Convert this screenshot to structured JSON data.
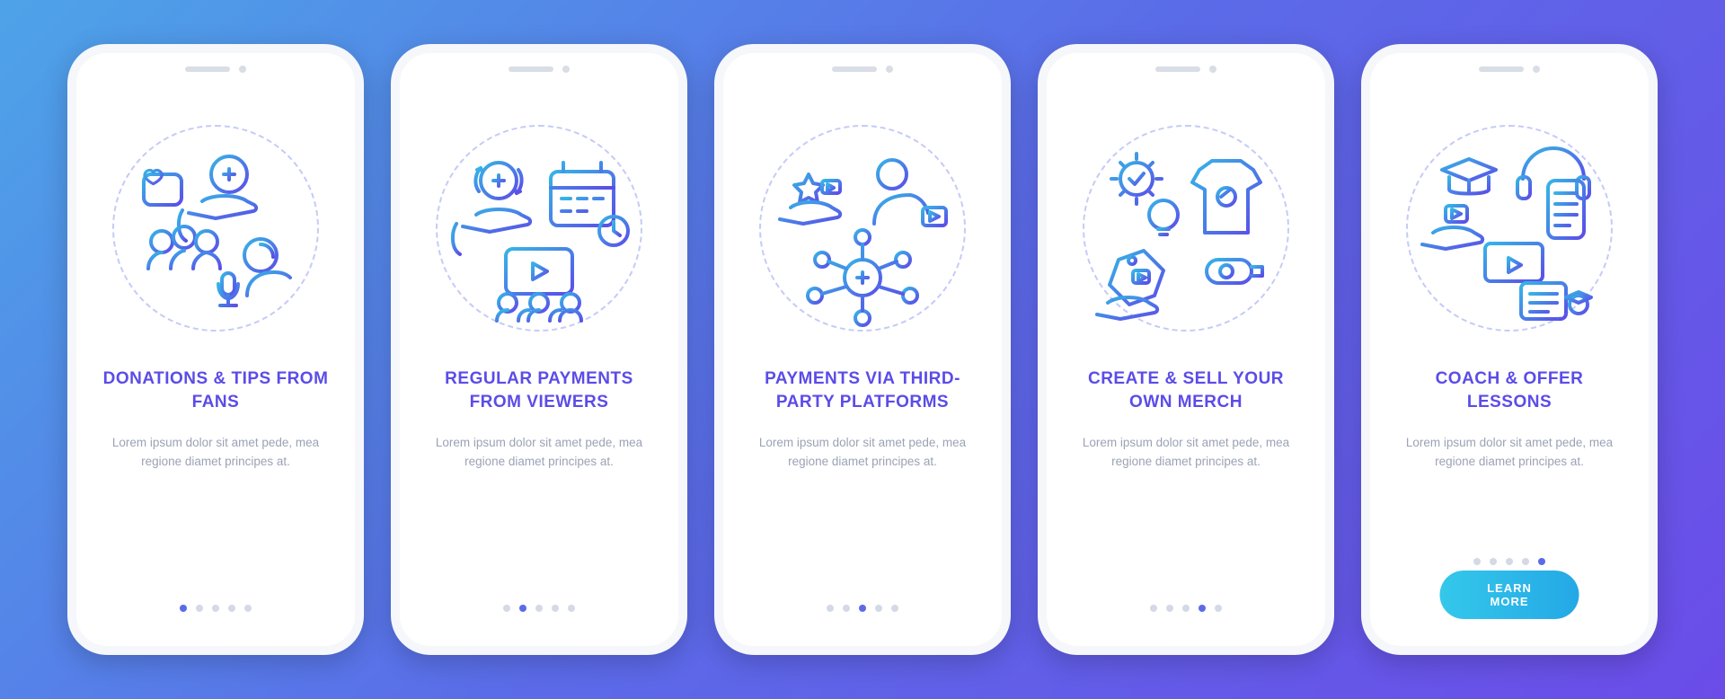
{
  "lorem": "Lorem ipsum dolor sit amet pede, mea regione diamet principes at.",
  "cta_label": "LEARN MORE",
  "icons": {
    "donations": "donations-tips-icon",
    "regular": "regular-payments-icon",
    "thirdparty": "third-party-payments-icon",
    "merch": "create-sell-merch-icon",
    "coach": "coach-lessons-icon"
  },
  "screens": [
    {
      "title": "DONATIONS & TIPS FROM FANS",
      "active_index": 0
    },
    {
      "title": "REGULAR PAYMENTS FROM VIEWERS",
      "active_index": 1
    },
    {
      "title": "PAYMENTS VIA THIRD-PARTY PLATFORMS",
      "active_index": 2
    },
    {
      "title": "CREATE & SELL YOUR OWN MERCH",
      "active_index": 3
    },
    {
      "title": "COACH & OFFER LESSONS",
      "active_index": 4,
      "has_cta": true
    }
  ]
}
